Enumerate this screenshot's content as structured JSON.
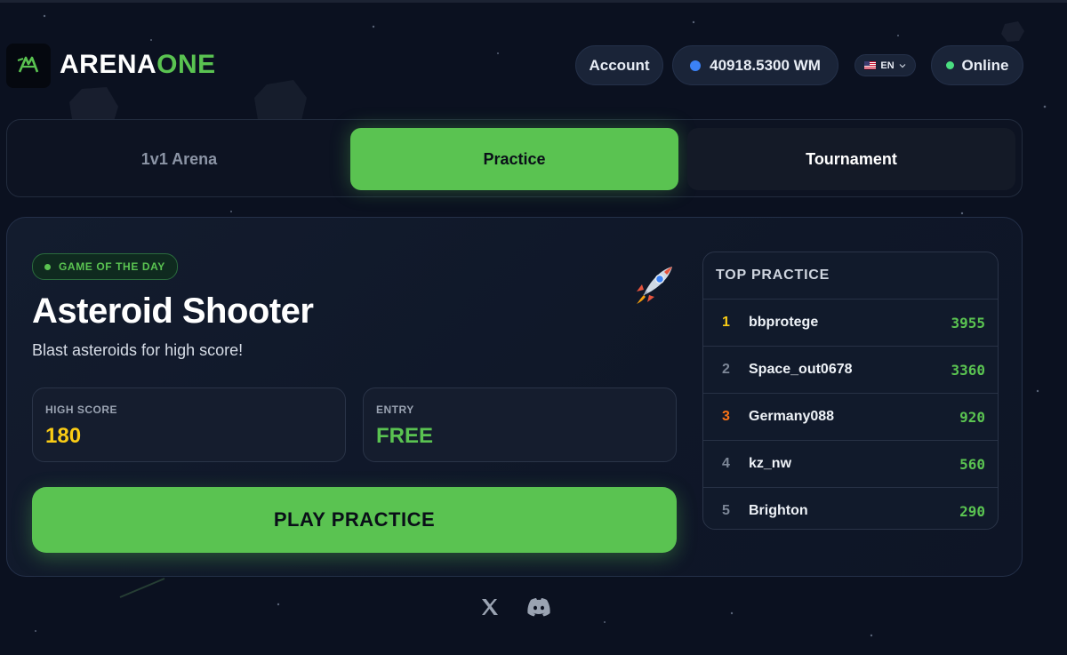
{
  "brand": {
    "part1": "ARENA",
    "part2": "ONE"
  },
  "header": {
    "account_label": "Account",
    "wallet_balance": "40918.5300 WM",
    "language": "EN",
    "status": "Online"
  },
  "tabs": [
    {
      "label": "1v1 Arena",
      "active": false
    },
    {
      "label": "Practice",
      "active": true
    },
    {
      "label": "Tournament",
      "active": false
    }
  ],
  "game": {
    "badge": "GAME OF THE DAY",
    "title": "Asteroid Shooter",
    "subtitle": "Blast asteroids for high score!",
    "icon": "rocket-icon",
    "high_score_label": "HIGH SCORE",
    "high_score": "180",
    "entry_label": "ENTRY",
    "entry": "FREE",
    "play_label": "PLAY PRACTICE"
  },
  "leaderboard": {
    "title": "TOP PRACTICE",
    "rows": [
      {
        "rank": "1",
        "name": "bbprotege",
        "score": "3955"
      },
      {
        "rank": "2",
        "name": "Space_out0678",
        "score": "3360"
      },
      {
        "rank": "3",
        "name": "Germany088",
        "score": "920"
      },
      {
        "rank": "4",
        "name": "kz_nw",
        "score": "560"
      },
      {
        "rank": "5",
        "name": "Brighton",
        "score": "290"
      }
    ]
  },
  "footer": {
    "icons": [
      "x-icon",
      "discord-icon"
    ]
  },
  "colors": {
    "accent": "#5ac351",
    "background": "#0b1120",
    "gold": "#facc15",
    "bronze": "#f97316"
  }
}
